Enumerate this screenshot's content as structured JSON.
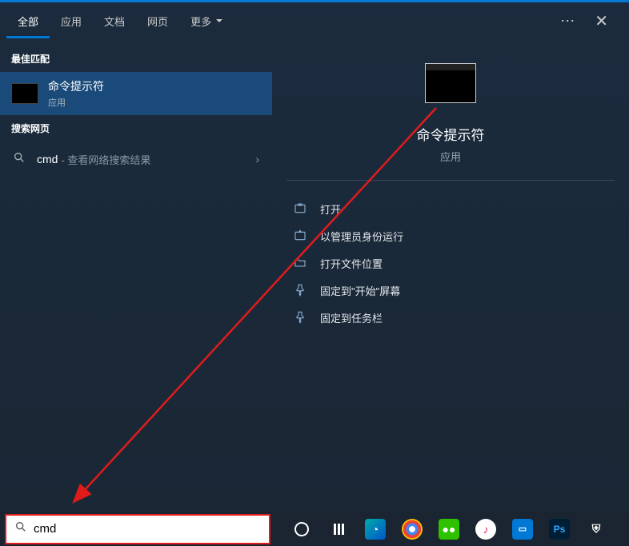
{
  "tabs": {
    "items": [
      "全部",
      "应用",
      "文档",
      "网页",
      "更多"
    ],
    "active_index": 0
  },
  "left": {
    "section_best": "最佳匹配",
    "best": {
      "title": "命令提示符",
      "subtitle": "应用"
    },
    "section_web": "搜索网页",
    "web": {
      "term": "cmd",
      "suffix": " - 查看网络搜索结果"
    }
  },
  "preview": {
    "title": "命令提示符",
    "subtitle": "应用",
    "actions": {
      "open": "打开",
      "admin": "以管理员身份运行",
      "location": "打开文件位置",
      "pin_start": "固定到\"开始\"屏幕",
      "pin_taskbar": "固定到任务栏"
    }
  },
  "search": {
    "value": "cmd"
  }
}
